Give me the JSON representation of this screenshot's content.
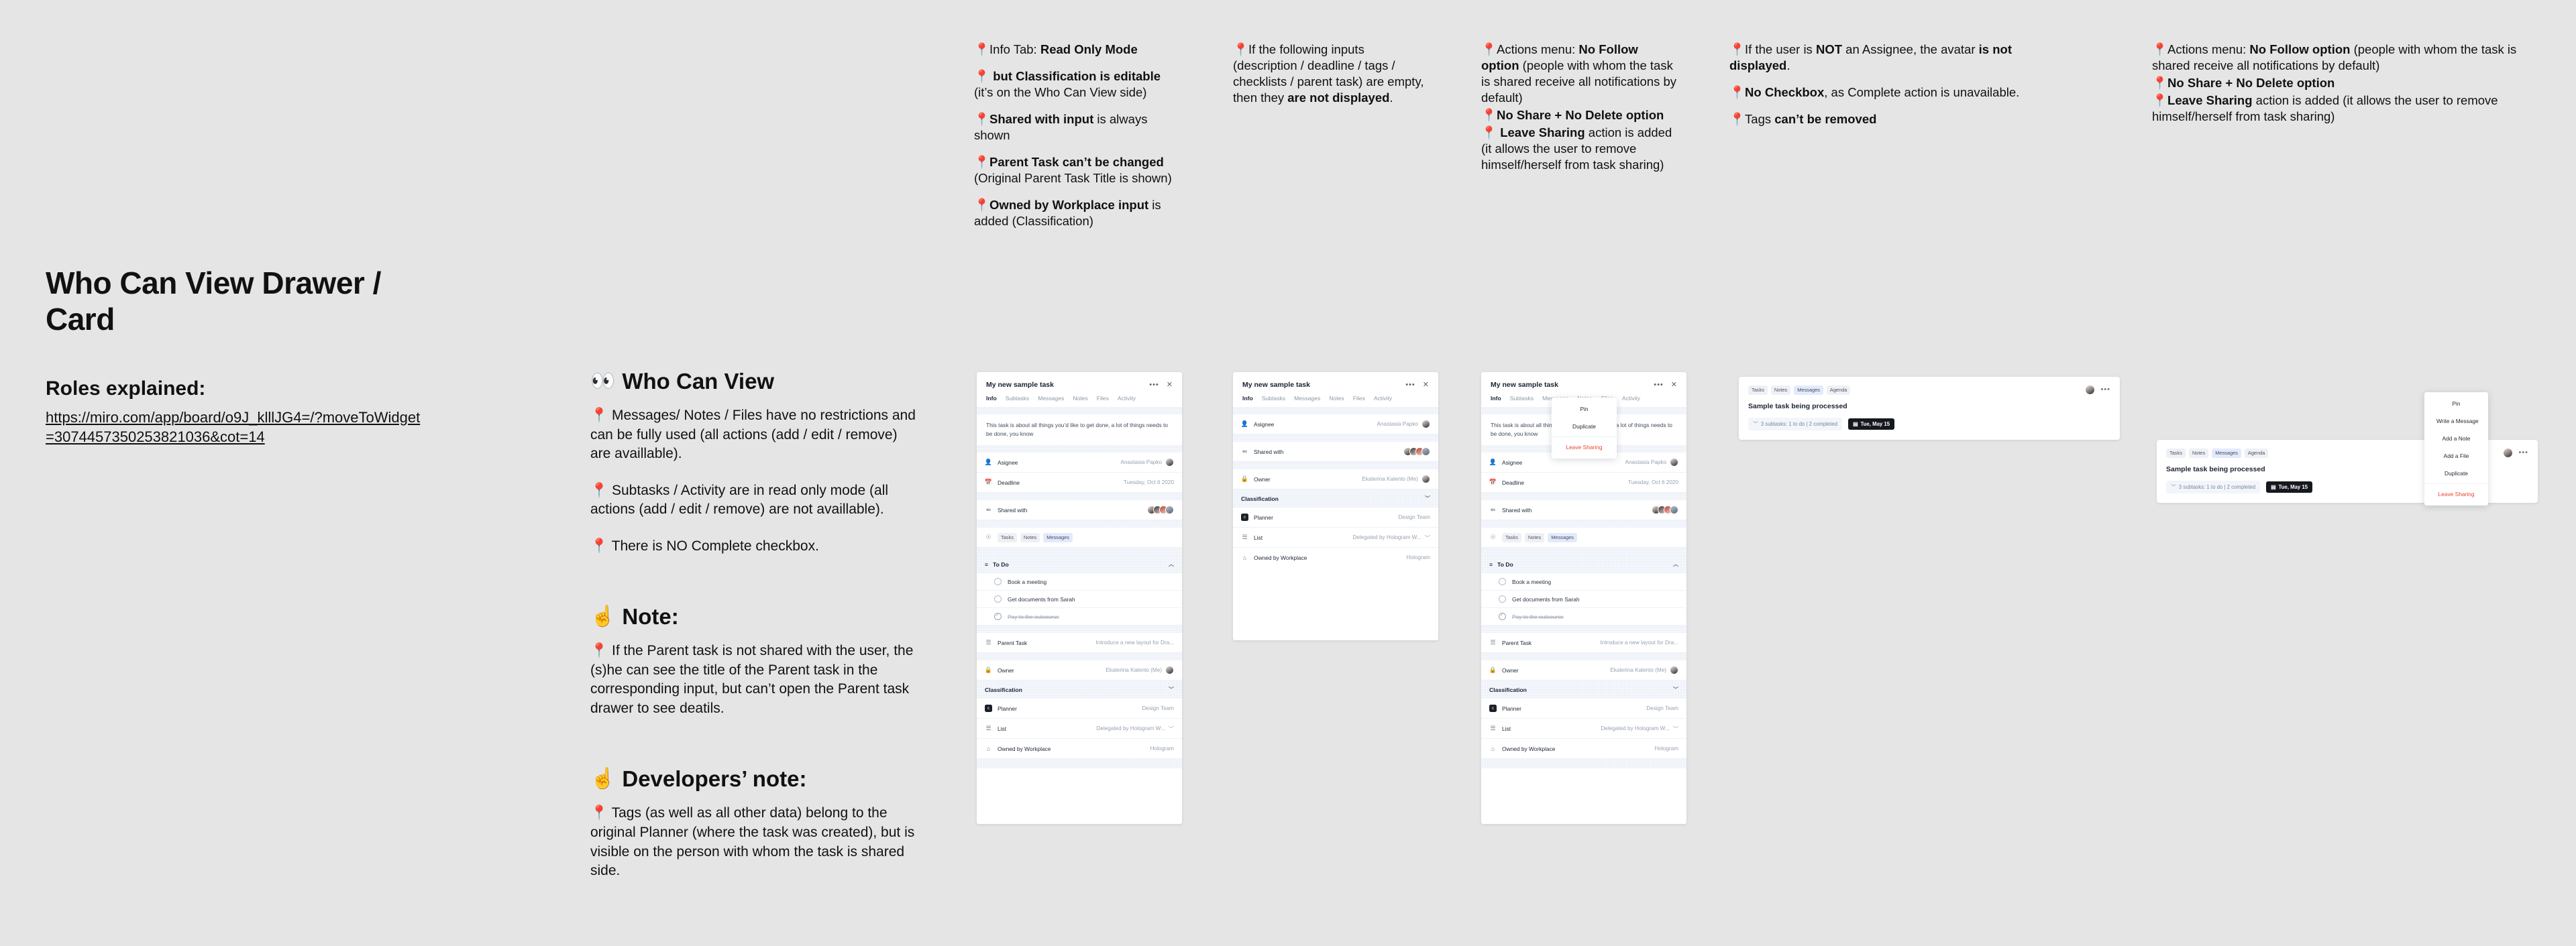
{
  "doc": {
    "title": "Who Can View Drawer / Card",
    "roles_heading": "Roles explained:",
    "roles_link": "https://miro.com/app/board/o9J_klllJG4=/?moveToWidget=3074457350253821036&cot=14"
  },
  "who_can_view": {
    "heading": "Who Can View",
    "heading_emoji": "👀",
    "bullets": [
      "Messages/ Notes / Files have no restrictions and can be fully used (all actions (add / edit / remove) are availlable).",
      "Subtasks / Activity are in read only mode (all actions (add / edit / remove) are not availlable).",
      "There is NO Complete checkbox."
    ]
  },
  "note": {
    "heading": "Note:",
    "heading_emoji": "☝️",
    "body": "If the Parent task is not shared with the user, the (s)he can see the title of the Parent task in the corresponding input, but can’t open the Parent task drawer to see deatils."
  },
  "dev_note": {
    "heading": "Developers’ note:",
    "heading_emoji": "☝️",
    "body": "Tags (as well as all other data) belong to the original Planner (where the task was created), but is visible on the person with whom the task is shared side."
  },
  "annotations": {
    "col1": [
      {
        "plain_before": "Info Tab: ",
        "bold": "Read Only Mode",
        "plain_after": ""
      },
      {
        "plain_before": " ",
        "bold": "but Classification is editable",
        "plain_after": " (it’s on the Who Can View side)"
      },
      {
        "plain_before": "",
        "bold": "Shared with input",
        "plain_after": " is always shown"
      },
      {
        "plain_before": "",
        "bold": "Parent Task can’t be changed",
        "plain_after": " (Original Parent Task Title is shown)"
      },
      {
        "plain_before": "",
        "bold": "Owned by Workplace input",
        "plain_after": " is added (Classification)"
      }
    ],
    "col2": [
      {
        "plain_before": "If the following inputs (description / deadline / tags / checklists / parent task) are empty, then they ",
        "bold": "are not displayed",
        "plain_after": "."
      }
    ],
    "col3": [
      {
        "plain_before": "Actions menu: ",
        "bold": "No Follow option",
        "plain_after": " (people with whom the task is shared receive all notifications by default)"
      },
      {
        "plain_before": "",
        "bold": "No Share + No Delete option",
        "plain_after": ""
      },
      {
        "plain_before": " ",
        "bold": "Leave Sharing",
        "plain_after": " action is added (it allows the user to remove himself/herself from task sharing)"
      }
    ],
    "col4": [
      {
        "plain_before": "If the user is ",
        "bold": "NOT",
        "plain_after": " an Assignee, the avatar ",
        "bold2": "is not displayed",
        "plain_after2": "."
      },
      {
        "plain_before": "",
        "bold": "No Checkbox",
        "plain_after": ", as Complete action is unavailable."
      },
      {
        "plain_before": "Tags ",
        "bold": "can’t be removed",
        "plain_after": ""
      }
    ],
    "col5": [
      {
        "plain_before": "Actions menu: ",
        "bold": "No Follow option",
        "plain_after": " (people with whom the task is shared receive all notifications by default)"
      },
      {
        "plain_before": "",
        "bold": "No Share + No Delete option",
        "plain_after": ""
      },
      {
        "plain_before": "",
        "bold": "Leave Sharing",
        "plain_after": " action is added (it allows the user to remove himself/herself from task sharing)"
      }
    ]
  },
  "drawer": {
    "title": "My new sample task",
    "tabs": [
      "Info",
      "Subtasks",
      "Messages",
      "Notes",
      "Files",
      "Activity"
    ],
    "active_tab": "Info",
    "description": "This task is about all things you’d like to get done, a lot of things needs to be done, you know",
    "rows": {
      "assignee_label": "Asignee",
      "assignee_value": "Anastasia Papko",
      "deadline_label": "Deadline",
      "deadline_value": "Tuesday, Oct 6 2020",
      "shared_label": "Shared with",
      "parent_label": "Parent Task",
      "parent_value": "Introduce a new layout for Dra...",
      "owner_label": "Owner",
      "owner_value": "Ekaterina Kalento (Me)"
    },
    "tags": [
      "Tasks",
      "Notes",
      "Messages"
    ],
    "todo_heading": "To Do",
    "todo_items": [
      {
        "text": "Book a meeting",
        "done": false
      },
      {
        "text": "Get documents from Sarah",
        "done": false
      },
      {
        "text": "Pay to the outsourse",
        "done": true
      }
    ],
    "classification_heading": "Classification",
    "classification_rows": [
      {
        "label": "Planner",
        "value": "Design Team",
        "badge": "c"
      },
      {
        "label": "List",
        "value": "Delegated by Hologram W...",
        "badge": ""
      },
      {
        "label": "Owned by Workplace",
        "value": "Hologram",
        "badge": ""
      }
    ]
  },
  "drawer_menu": {
    "items": [
      "Pin",
      "Duplicate"
    ],
    "danger_item": "Leave Sharing"
  },
  "task_card": {
    "chips": [
      "Tasks",
      "Notes",
      "Messages",
      "Agenda"
    ],
    "active_chip": "Messages",
    "title": "Sample task being processed",
    "subtasks_text": "3 subtasks: 1 to do | 2 completed",
    "date_text": "Tue, May 15"
  },
  "card_menu": {
    "items": [
      "Pin",
      "Write a Message",
      "Add a Note",
      "Add a File",
      "Duplicate"
    ],
    "danger_item": "Leave Sharing"
  },
  "colors": {
    "background": "#e5e5e5",
    "pin": "#d9382c",
    "danger": "#e8442f",
    "dark": "#15181e"
  }
}
